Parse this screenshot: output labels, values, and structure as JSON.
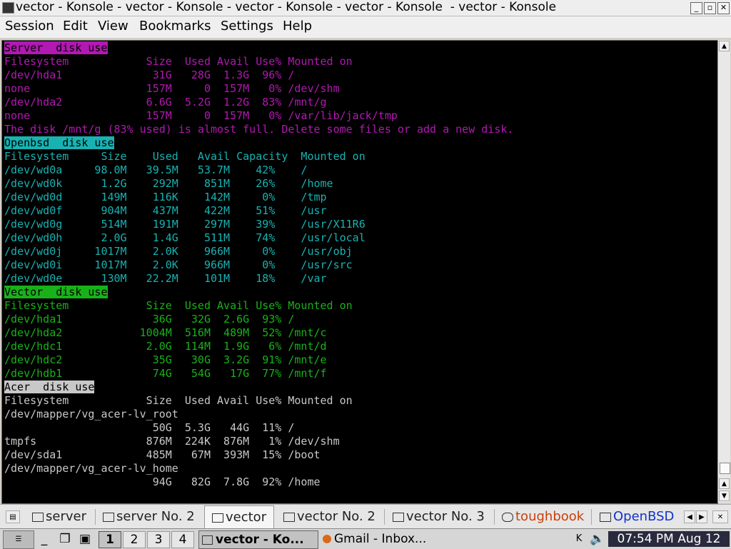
{
  "window": {
    "title": "vector - Konsole - vector - Konsole - vector - Konsole - vector - Konsole  - vector - Konsole"
  },
  "menu": [
    "Session",
    "Edit",
    "View",
    "Bookmarks",
    "Settings",
    "Help"
  ],
  "colors": {
    "server": "#b218b2",
    "openbsd": "#18b2b2",
    "vector": "#18b218",
    "acer": "#c8c8c8"
  },
  "sections": [
    {
      "color": "server",
      "title": "Server  disk use",
      "lines": [
        "Filesystem            Size  Used Avail Use% Mounted on",
        "/dev/hda1              31G   28G  1.3G  96% /",
        "none                  157M     0  157M   0% /dev/shm",
        "/dev/hda2             6.6G  5.2G  1.2G  83% /mnt/g",
        "none                  157M     0  157M   0% /var/lib/jack/tmp",
        "The disk /mnt/g (83% used) is almost full. Delete some files or add a new disk."
      ]
    },
    {
      "color": "openbsd",
      "title": "Openbsd  disk use",
      "lines": [
        "Filesystem     Size    Used   Avail Capacity  Mounted on",
        "/dev/wd0a     98.0M   39.5M   53.7M    42%    /",
        "/dev/wd0k      1.2G    292M    851M    26%    /home",
        "/dev/wd0d      149M    116K    142M     0%    /tmp",
        "/dev/wd0f      904M    437M    422M    51%    /usr",
        "/dev/wd0g      514M    191M    297M    39%    /usr/X11R6",
        "/dev/wd0h      2.0G    1.4G    511M    74%    /usr/local",
        "/dev/wd0j     1017M    2.0K    966M     0%    /usr/obj",
        "/dev/wd0i     1017M    2.0K    966M     0%    /usr/src",
        "/dev/wd0e      130M   22.2M    101M    18%    /var"
      ]
    },
    {
      "color": "vector",
      "title": "Vector  disk use",
      "lines": [
        "Filesystem            Size  Used Avail Use% Mounted on",
        "/dev/hda1              36G   32G  2.6G  93% /",
        "/dev/hda2            1004M  516M  489M  52% /mnt/c",
        "/dev/hdc1             2.0G  114M  1.9G   6% /mnt/d",
        "/dev/hdc2              35G   30G  3.2G  91% /mnt/e",
        "/dev/hdb1              74G   54G   17G  77% /mnt/f"
      ]
    },
    {
      "color": "acer",
      "title": "Acer  disk use",
      "lines": [
        "Filesystem            Size  Used Avail Use% Mounted on",
        "/dev/mapper/vg_acer-lv_root",
        "                       50G  5.3G   44G  11% /",
        "tmpfs                 876M  224K  876M   1% /dev/shm",
        "/dev/sda1             485M   67M  393M  15% /boot",
        "/dev/mapper/vg_acer-lv_home",
        "                       94G   82G  7.8G  92% /home"
      ]
    }
  ],
  "tabs": [
    {
      "label": "server",
      "active": false,
      "icon": "terminal-icon"
    },
    {
      "label": "server No. 2",
      "active": false,
      "icon": "terminal-icon"
    },
    {
      "label": "vector",
      "active": true,
      "icon": "terminal-icon"
    },
    {
      "label": "vector No. 2",
      "active": false,
      "icon": "terminal-icon"
    },
    {
      "label": "vector No. 3",
      "active": false,
      "icon": "terminal-icon"
    },
    {
      "label": "toughbook",
      "active": false,
      "icon": "terminal-icon"
    },
    {
      "label": "OpenBSD",
      "active": false,
      "icon": "terminal-icon"
    }
  ],
  "taskbar": {
    "desktops": [
      "1",
      "2",
      "3",
      "4"
    ],
    "active_desktop": "1",
    "windows": [
      "vector - Ko...",
      "Gmail - Inbox..."
    ],
    "clock": "07:54 PM Aug 12"
  }
}
